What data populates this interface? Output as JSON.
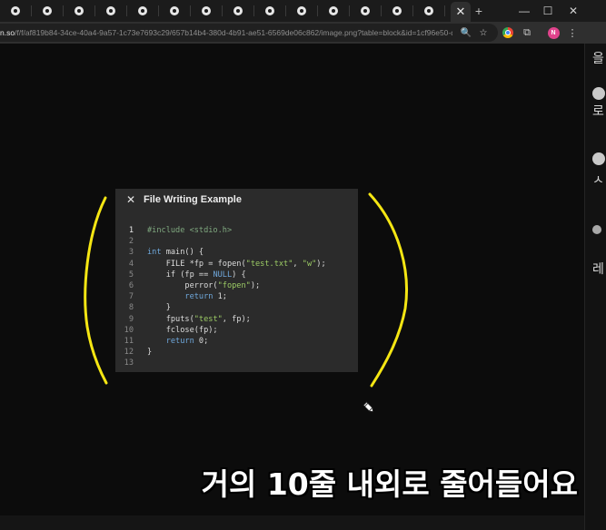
{
  "browser": {
    "tabs": [
      {
        "icon": "notion-favicon-icon"
      },
      {
        "icon": "notion-favicon-icon"
      },
      {
        "icon": "notion-favicon-icon"
      },
      {
        "icon": "notion-favicon-icon"
      },
      {
        "icon": "notion-favicon-icon"
      },
      {
        "icon": "notion-favicon-icon"
      },
      {
        "icon": "notion-favicon-icon"
      },
      {
        "icon": "notion-favicon-icon"
      },
      {
        "icon": "notion-favicon-icon"
      },
      {
        "icon": "notion-favicon-icon"
      },
      {
        "icon": "notion-favicon-icon"
      },
      {
        "icon": "notion-favicon-icon"
      },
      {
        "icon": "notion-favicon-icon"
      },
      {
        "icon": "notion-favicon-icon"
      }
    ],
    "active_tab_close": "✕",
    "new_tab": "+",
    "window_minimize": "—",
    "window_maximize": "☐",
    "window_close": "✕",
    "url_host": "n.so",
    "url_rest": "/f/f/af819b84-34ce-40a4-9a57-1c73e7693c29/657b14b4-380d-4b91-ae51-6569de06c862/image.png?table=block&id=1cf96e50-d58...",
    "zoom_icon": "🔍",
    "star_icon": "☆",
    "extensions_icon": "⧉",
    "profile_initial": "N",
    "menu_icon": "⋮",
    "sidebar_glyphs": [
      "을",
      "로",
      "ㅅ",
      "레"
    ]
  },
  "panel": {
    "close_label": "✕",
    "title": "File Writing Example",
    "active_line": 1,
    "lines": [
      {
        "n": "1",
        "tokens": [
          {
            "t": "#include <stdio.h>",
            "c": "pp"
          }
        ]
      },
      {
        "n": "2",
        "tokens": []
      },
      {
        "n": "3",
        "tokens": [
          {
            "t": "int",
            "c": "kw"
          },
          {
            "t": " main() {",
            "c": "plain"
          }
        ]
      },
      {
        "n": "4",
        "tokens": [
          {
            "t": "    FILE *fp = fopen(",
            "c": "plain"
          },
          {
            "t": "\"test.txt\"",
            "c": "str"
          },
          {
            "t": ", ",
            "c": "plain"
          },
          {
            "t": "\"w\"",
            "c": "str"
          },
          {
            "t": ");",
            "c": "plain"
          }
        ]
      },
      {
        "n": "5",
        "tokens": [
          {
            "t": "    if (fp == ",
            "c": "plain"
          },
          {
            "t": "NULL",
            "c": "kw"
          },
          {
            "t": ") {",
            "c": "plain"
          }
        ]
      },
      {
        "n": "6",
        "tokens": [
          {
            "t": "        perror(",
            "c": "plain"
          },
          {
            "t": "\"fopen\"",
            "c": "str"
          },
          {
            "t": ");",
            "c": "plain"
          }
        ]
      },
      {
        "n": "7",
        "tokens": [
          {
            "t": "        ",
            "c": "plain"
          },
          {
            "t": "return",
            "c": "kw"
          },
          {
            "t": " 1;",
            "c": "plain"
          }
        ]
      },
      {
        "n": "8",
        "tokens": [
          {
            "t": "    }",
            "c": "plain"
          }
        ]
      },
      {
        "n": "9",
        "tokens": [
          {
            "t": "    fputs(",
            "c": "plain"
          },
          {
            "t": "\"test\"",
            "c": "str"
          },
          {
            "t": ", fp);",
            "c": "plain"
          }
        ]
      },
      {
        "n": "10",
        "tokens": [
          {
            "t": "    fclose(fp);",
            "c": "plain"
          }
        ]
      },
      {
        "n": "11",
        "tokens": [
          {
            "t": "    ",
            "c": "plain"
          },
          {
            "t": "return",
            "c": "kw"
          },
          {
            "t": " 0;",
            "c": "plain"
          }
        ]
      },
      {
        "n": "12",
        "tokens": [
          {
            "t": "}",
            "c": "plain"
          }
        ]
      },
      {
        "n": "13",
        "tokens": []
      }
    ]
  },
  "subtitle": "거의 10줄 내외로 줄어들어요",
  "colors": {
    "annotation": "#f5e613",
    "background": "#0c0c0c",
    "panel": "#2b2b2b",
    "keyword": "#6fa8dc",
    "string": "#9ccc65",
    "preprocessor": "#7fa87f"
  },
  "cursor_icon": "pencil-cursor-icon"
}
